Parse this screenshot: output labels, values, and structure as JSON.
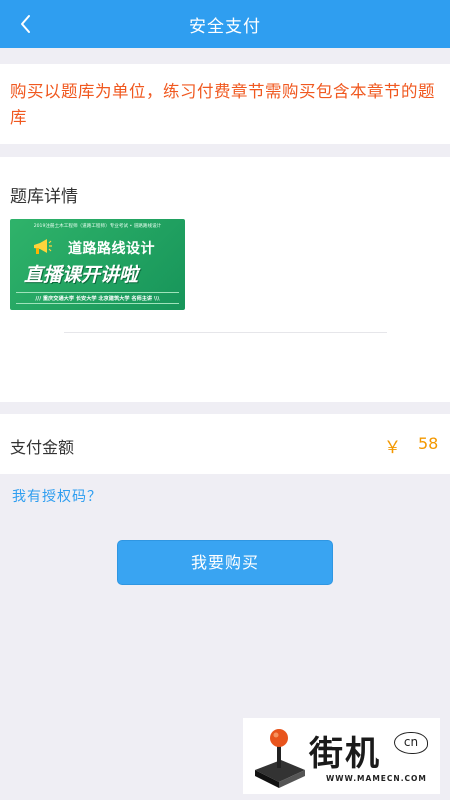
{
  "header": {
    "title": "安全支付",
    "back_icon": "chevron-left-icon"
  },
  "notice": {
    "text": "购买以题库为单位，练习付费章节需购买包含本章节的题库"
  },
  "detail": {
    "title": "题库详情",
    "cover": {
      "top_line": "2019注册土木工程师（道路工程师）专业考试 • 道路路线设计",
      "line1": "道路路线设计",
      "line2": "直播课开讲啦",
      "bottom_line": "重庆交通大学  长安大学  北京建筑大学  名师主讲",
      "bottom_left": "///",
      "bottom_right": "\\\\\\"
    }
  },
  "payment": {
    "label": "支付金额",
    "currency": "￥",
    "amount": "58"
  },
  "auth_link": "我有授权码？",
  "buy_button": "我要购买",
  "watermark": {
    "text": "街机",
    "badge": "cn",
    "url": "WWW.MAMECN.COM"
  },
  "colors": {
    "header": "#2f9ef0",
    "notice": "#f0581f",
    "price": "#f39800",
    "link": "#2f9ef0",
    "button": "#39a4f2"
  }
}
